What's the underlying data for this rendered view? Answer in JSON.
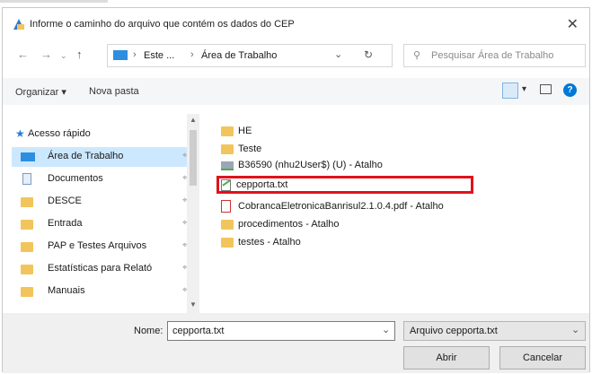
{
  "window": {
    "title": "Informe o caminho do arquivo que contém os dados do CEP",
    "close_icon": "close-icon"
  },
  "navigation": {
    "breadcrumb": [
      "Este ...",
      "Área de Trabalho"
    ],
    "search_placeholder": "Pesquisar Área de Trabalho"
  },
  "toolbar": {
    "organize_label": "Organizar ▾",
    "new_folder_label": "Nova pasta"
  },
  "sidebar": {
    "quick_access_label": "Acesso rápido",
    "items": [
      {
        "label": "Área de Trabalho",
        "icon": "desktop-icon"
      },
      {
        "label": "Documentos",
        "icon": "documents-icon"
      },
      {
        "label": "DESCE",
        "icon": "folder-icon"
      },
      {
        "label": "Entrada",
        "icon": "folder-icon"
      },
      {
        "label": "PAP e Testes Arquivos",
        "icon": "folder-icon"
      },
      {
        "label": "Estatísticas para Relató",
        "icon": "folder-icon"
      },
      {
        "label": "Manuais",
        "icon": "folder-icon"
      }
    ]
  },
  "files": [
    {
      "name": "HE",
      "icon": "folder-icon"
    },
    {
      "name": "Teste",
      "icon": "folder-icon"
    },
    {
      "name": "B36590 (nhu2User$) (U) - Atalho",
      "icon": "network-drive-shortcut-icon"
    },
    {
      "name": "cepporta.txt",
      "icon": "text-file-icon",
      "highlighted": true
    },
    {
      "name": "CobrancaEletronicaBanrisul2.1.0.4.pdf - Atalho",
      "icon": "pdf-shortcut-icon"
    },
    {
      "name": "procedimentos - Atalho",
      "icon": "folder-shortcut-icon"
    },
    {
      "name": "testes - Atalho",
      "icon": "folder-shortcut-icon"
    }
  ],
  "footer": {
    "name_label": "Nome:",
    "name_value": "cepporta.txt",
    "filter_value": "Arquivo cepporta.txt",
    "open_label": "Abrir",
    "cancel_label": "Cancelar"
  },
  "colors": {
    "highlight_border": "#e0121c",
    "selected_bg": "#cce8ff",
    "folder": "#f2c55c",
    "accent": "#0078d7"
  }
}
